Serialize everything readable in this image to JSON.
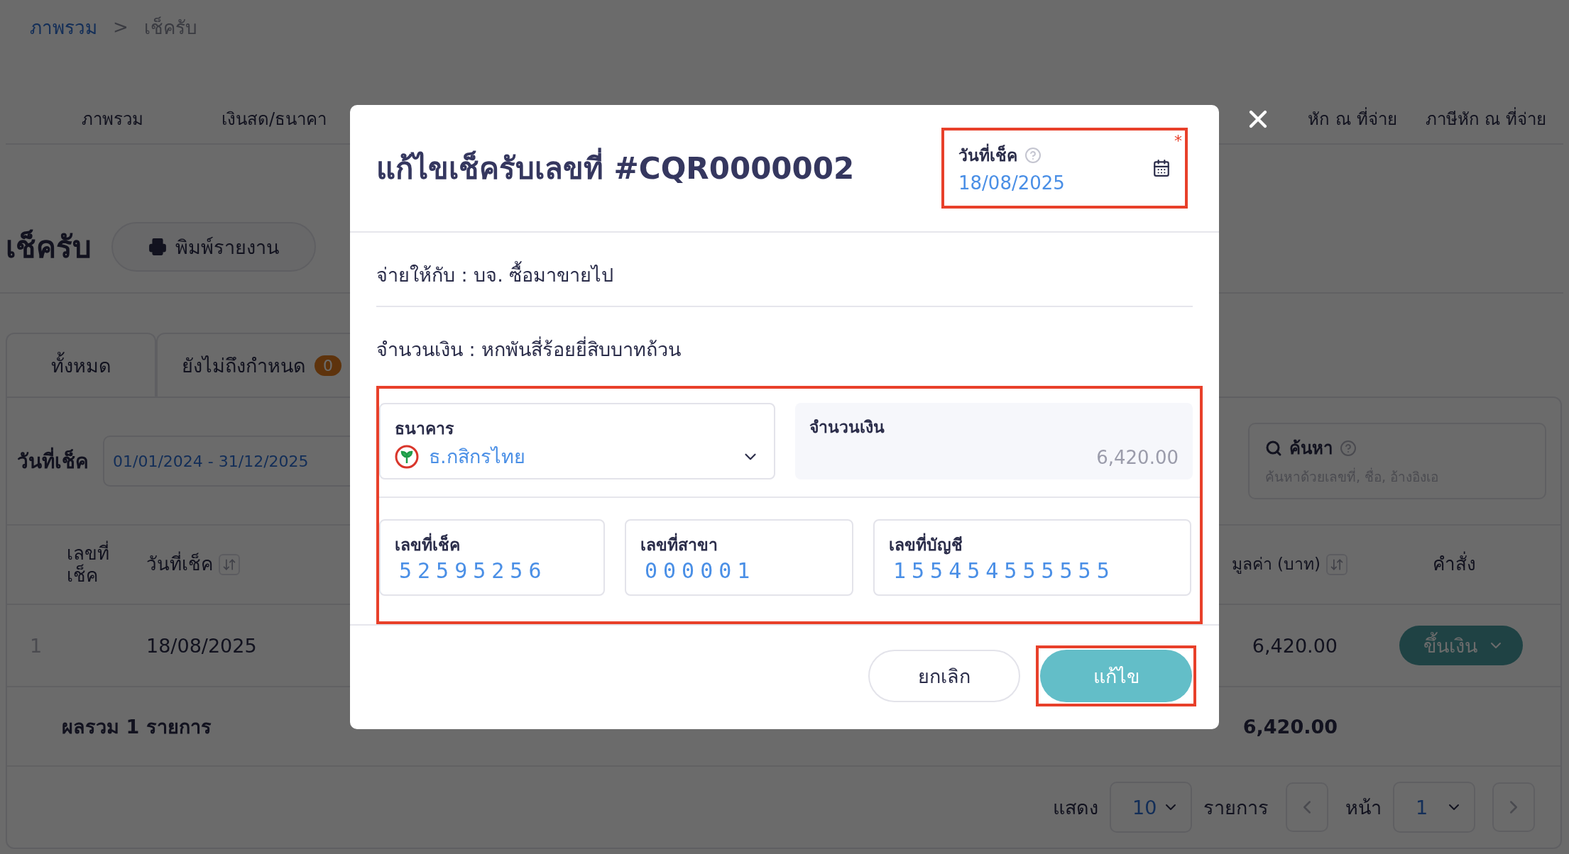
{
  "breadcrumb": {
    "items": [
      {
        "label": "ภาพรวม",
        "link": true
      },
      {
        "label": "เช็ครับ",
        "link": false
      }
    ],
    "separator": ">"
  },
  "nav_tabs": {
    "left": [
      "ภาพรวม",
      "เงินสด/ธนาคา"
    ],
    "right": [
      "หัก ณ ที่จ่าย",
      "ภาษีหัก ณ ที่จ่าย"
    ]
  },
  "page_title": "เช็ครับ",
  "print_button": "พิมพ์รายงาน",
  "status_tabs": [
    {
      "label": "ทั้งหมด"
    },
    {
      "label": "ยังไม่ถึงกำหนด",
      "count": "0"
    }
  ],
  "filter": {
    "label": "วันที่เช็ค",
    "date_range": "01/01/2024 - 31/12/2025"
  },
  "search": {
    "label": "ค้นหา",
    "placeholder": "ค้นหาด้วยเลขที่, ชื่อ, อ้างอิงเอ"
  },
  "table": {
    "columns": [
      {
        "label": "เลขที่ เช็ค",
        "sortable": false
      },
      {
        "label": "วันที่เช็ค",
        "sortable": true
      },
      {
        "label": "มูลค่า (บาท)",
        "sortable": true
      },
      {
        "label": "คำสั่ง",
        "sortable": false
      }
    ],
    "rows": [
      {
        "index": "1",
        "date": "18/08/2025",
        "amount": "6,420.00",
        "action": "ขึ้นเงิน"
      }
    ],
    "total": {
      "label": "ผลรวม 1 รายการ",
      "amount": "6,420.00"
    }
  },
  "pagination": {
    "show_label": "แสดง",
    "page_size": "10",
    "items_label": "รายการ",
    "page_label": "หน้า",
    "page": "1"
  },
  "modal": {
    "title": "แก้ไขเช็ครับเลขที่ #CQR0000002",
    "date_field": {
      "label": "วันที่เช็ค",
      "value": "18/08/2025",
      "required_mark": "*",
      "highlighted": true
    },
    "payee": "จ่ายให้กับ : บจ. ซื้อมาขายไป",
    "amount_text": "จำนวนเงิน : หกพันสี่ร้อยยี่สิบบาทถ้วน",
    "details": {
      "highlighted": true,
      "bank": {
        "label": "ธนาคาร",
        "value": "ธ.กสิกรไทย"
      },
      "amount": {
        "label": "จำนวนเงิน",
        "value": "6,420.00"
      },
      "fields": [
        {
          "label": "เลขที่เช็ค",
          "value": "52595256"
        },
        {
          "label": "เลขที่สาขา",
          "value": "000001"
        },
        {
          "label": "เลขที่บัญชี",
          "value": "155454555555"
        }
      ]
    },
    "buttons": [
      {
        "label": "ยกเลิก",
        "kind": "secondary",
        "highlighted": false
      },
      {
        "label": "แก้ไข",
        "kind": "primary",
        "highlighted": true
      }
    ]
  }
}
